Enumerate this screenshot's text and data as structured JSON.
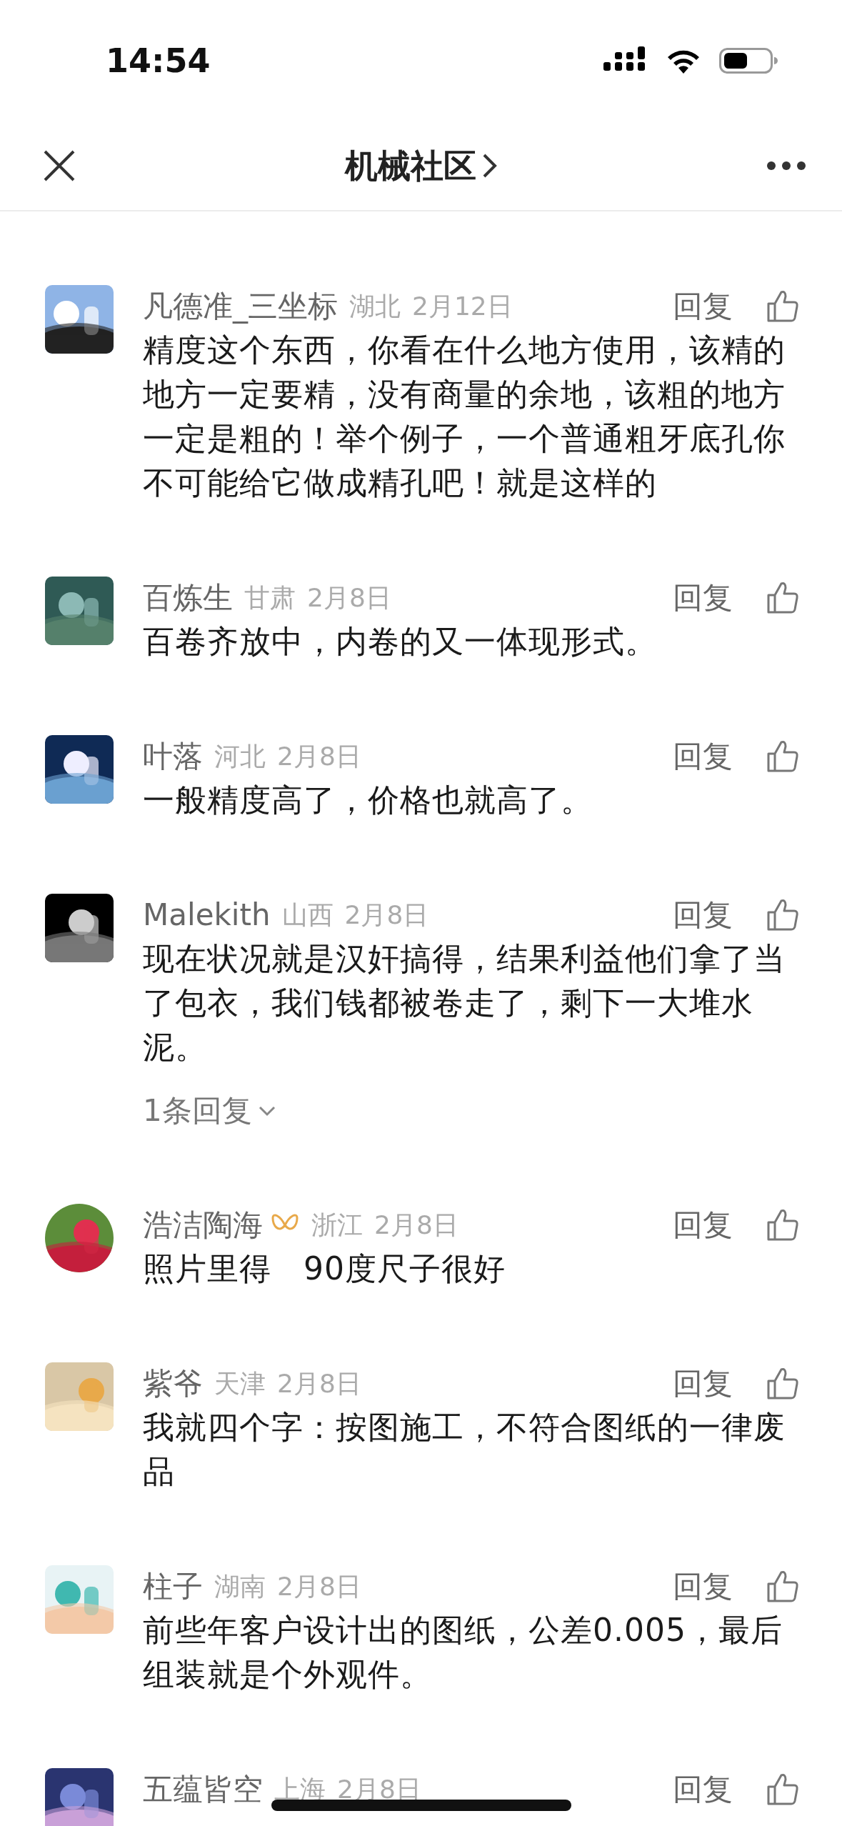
{
  "status_bar": {
    "time": "14:54"
  },
  "header": {
    "title": "机械社区"
  },
  "comments": [
    {
      "avatar": {
        "kind": "picture",
        "round": false
      },
      "name": "凡德准_三坐标",
      "vip_badge": false,
      "location": "湖北",
      "date": "2月12日",
      "reply": "回复",
      "text": "精度这个东西，你看在什么地方使用，该精的地方一定要精，没有商量的余地，该粗的地方一定是粗的！举个例子，一个普通粗牙底孔你不可能给它做成精孔吧！就是这样的"
    },
    {
      "avatar": {
        "kind": "picture",
        "round": false
      },
      "name": "百炼生",
      "vip_badge": false,
      "location": "甘肃",
      "date": "2月8日",
      "reply": "回复",
      "text": "百卷齐放中，内卷的又一体现形式。"
    },
    {
      "avatar": {
        "kind": "picture",
        "round": false
      },
      "name": "叶落",
      "vip_badge": false,
      "location": "河北",
      "date": "2月8日",
      "reply": "回复",
      "text": "一般精度高了，价格也就高了。"
    },
    {
      "avatar": {
        "kind": "picture",
        "round": false
      },
      "name": "Malekith",
      "vip_badge": false,
      "location": "山西",
      "date": "2月8日",
      "reply": "回复",
      "text": "现在状况就是汉奸搞得，结果利益他们拿了当了包衣，我们钱都被卷走了，剩下一大堆水泥。",
      "replies_link": "1条回复"
    },
    {
      "avatar": {
        "kind": "picture",
        "round": true
      },
      "name": "浩洁陶海",
      "vip_badge": true,
      "location": "浙江",
      "date": "2月8日",
      "reply": "回复",
      "text": "照片里得　90度尺子很好"
    },
    {
      "avatar": {
        "kind": "picture",
        "round": false
      },
      "name": "紫爷",
      "vip_badge": false,
      "location": "天津",
      "date": "2月8日",
      "reply": "回复",
      "text": "我就四个字：按图施工，不符合图纸的一律废品"
    },
    {
      "avatar": {
        "kind": "picture",
        "round": false
      },
      "name": "柱子",
      "vip_badge": false,
      "location": "湖南",
      "date": "2月8日",
      "reply": "回复",
      "text": "前些年客户设计出的图纸，公差0.005，最后组装就是个外观件。"
    },
    {
      "avatar": {
        "kind": "picture",
        "round": false
      },
      "name": "五蕴皆空",
      "vip_badge": false,
      "location": "上海",
      "date": "2月8日",
      "reply": "回复"
    }
  ]
}
